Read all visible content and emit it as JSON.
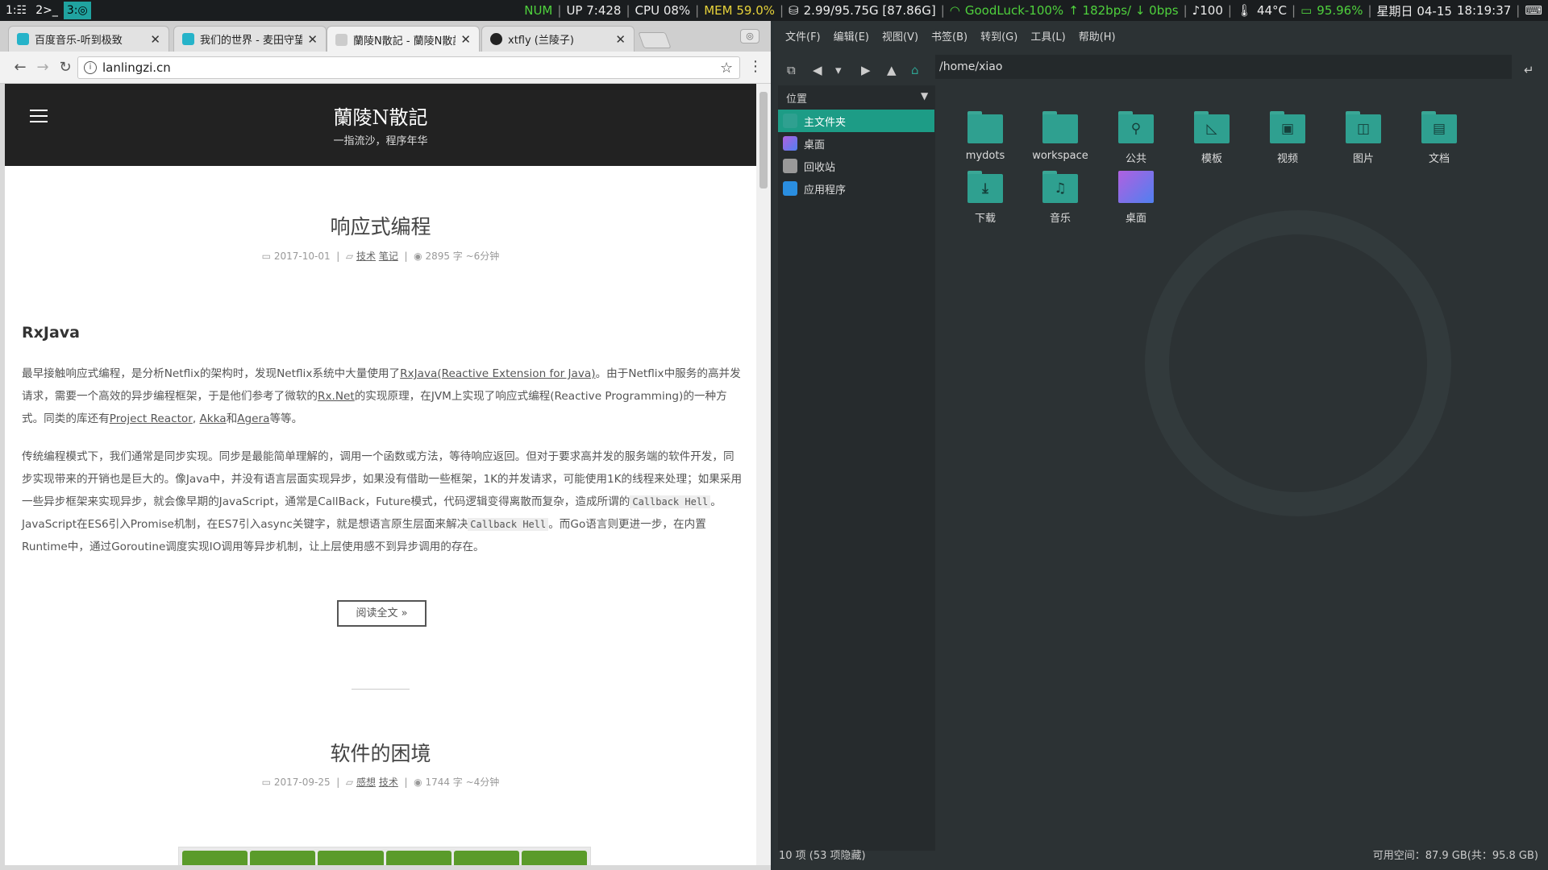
{
  "topbar": {
    "workspaces": [
      "1",
      "2",
      "3"
    ],
    "num": "NUM",
    "uptime": "UP 7:428",
    "cpu": "CPU 08%",
    "mem": "MEM 59.0%",
    "disk": "2.99/95.75G [87.86G]",
    "wifi": "GoodLuck-100%",
    "net": "↑ 182bps/ ↓ 0bps",
    "volume": "♪100",
    "temp": "44°C",
    "battery": "95.96%",
    "date": "星期日 04-15",
    "time": "18:19:37"
  },
  "browser": {
    "tabs": [
      {
        "title": "百度音乐-听到极致",
        "color": "#26b3c9"
      },
      {
        "title": "我们的世界 - 麦田守望",
        "color": "#26b3c9"
      },
      {
        "title": "蘭陵N散記 - 蘭陵N散記",
        "color": "#888888"
      },
      {
        "title": "xtfly (兰陵子)",
        "color": "#222222"
      }
    ],
    "url": "lanlingzi.cn"
  },
  "site": {
    "title": "蘭陵N散記",
    "subtitle": "一指流沙，程序年华",
    "posts": [
      {
        "title": "响应式编程",
        "date": "2017-10-01",
        "tags": [
          "技术",
          "笔记"
        ],
        "stats": "2895 字 ~6分钟"
      },
      {
        "title": "软件的困境",
        "date": "2017-09-25",
        "tags": [
          "感想",
          "技术"
        ],
        "stats": "1744 字 ~4分钟"
      }
    ],
    "heading": "RxJava",
    "p1a": "最早接触响应式编程，是分析Netflix的架构时，发现Netflix系统中大量使用了",
    "p1link1": "RxJava(Reactive Extension for Java)",
    "p1b": "。由于Netflix中服务的高并发请求，需要一个高效的异步编程框架，于是他们参考了微软的",
    "p1link2": "Rx.Net",
    "p1c": "的实现原理，在JVM上实现了响应式编程(Reactive Programming)的一种方式。同类的库还有",
    "p1link3": "Project Reactor",
    "p1d": ", ",
    "p1link4": "Akka",
    "p1e": "和",
    "p1link5": "Agera",
    "p1f": "等等。",
    "p2a": "传统编程模式下，我们通常是同步实现。同步是最能简单理解的，调用一个函数或方法，等待响应返回。但对于要求高并发的服务端的软件开发，同步实现带来的开销也是巨大的。像Java中，并没有语言层面实现异步，如果没有借助一些框架，1K的并发请求，可能使用1K的线程来处理；如果采用一些异步框架来实现异步，就会像早期的JavaScript，通常是CallBack，Future模式，代码逻辑变得离散而复杂，造成所谓的",
    "p2code1": "Callback Hell",
    "p2b": "。JavaScript在ES6引入Promise机制，在ES7引入async关键字，就是想语言原生层面来解决",
    "p2code2": "Callback Hell",
    "p2c": "。而Go语言则更进一步，在内置Runtime中，通过Goroutine调度实现IO调用等异步机制，让上层使用感不到异步调用的存在。",
    "readmore": "阅读全文 »"
  },
  "fm": {
    "menu": [
      "文件(F)",
      "编辑(E)",
      "视图(V)",
      "书签(B)",
      "转到(G)",
      "工具(L)",
      "帮助(H)"
    ],
    "path": "/home/xiao",
    "sidebar_header": "位置",
    "sidebar": [
      {
        "label": "主文件夹",
        "icon": "home-icon",
        "color": "#2fa090"
      },
      {
        "label": "桌面",
        "icon": "desktop-icon",
        "color": "#9060d0"
      },
      {
        "label": "回收站",
        "icon": "trash-icon",
        "color": "#999999"
      },
      {
        "label": "应用程序",
        "icon": "applications-icon",
        "color": "#2a8ee0"
      }
    ],
    "items": [
      {
        "label": "mydots",
        "glyph": ""
      },
      {
        "label": "workspace",
        "glyph": ""
      },
      {
        "label": "公共",
        "glyph": "⚲"
      },
      {
        "label": "模板",
        "glyph": "◺"
      },
      {
        "label": "视频",
        "glyph": "▣"
      },
      {
        "label": "图片",
        "glyph": "◫"
      },
      {
        "label": "文档",
        "glyph": "▤"
      },
      {
        "label": "下载",
        "glyph": "⤓"
      },
      {
        "label": "音乐",
        "glyph": "♫"
      },
      {
        "label": "桌面",
        "glyph": "desktop"
      }
    ],
    "status_left": "10 项 (53 项隐藏)",
    "status_right": "可用空间：87.9 GB(共：95.8 GB)"
  }
}
